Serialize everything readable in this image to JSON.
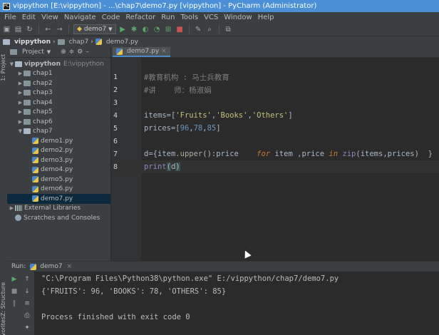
{
  "window": {
    "title": "vippython [E:\\vippython] - ...\\chap7\\demo7.py [vippython] - PyCharm (Administrator)"
  },
  "menu": [
    "File",
    "Edit",
    "View",
    "Navigate",
    "Code",
    "Refactor",
    "Run",
    "Tools",
    "VCS",
    "Window",
    "Help"
  ],
  "toolbar": {
    "run_config": "demo7"
  },
  "breadcrumb": [
    "vippython",
    "chap7",
    "demo7.py"
  ],
  "project_panel": {
    "title": "Project",
    "tool_window_label": "1: Project",
    "tree": [
      {
        "label": "vippython",
        "extra": "E:\\vippython",
        "type": "folder-open",
        "level": 0
      },
      {
        "label": "chap1",
        "type": "folder",
        "level": 1
      },
      {
        "label": "chap2",
        "type": "folder",
        "level": 1
      },
      {
        "label": "chap3",
        "type": "folder",
        "level": 1
      },
      {
        "label": "chap4",
        "type": "folder",
        "level": 1
      },
      {
        "label": "chap5",
        "type": "folder",
        "level": 1
      },
      {
        "label": "chap6",
        "type": "folder",
        "level": 1
      },
      {
        "label": "chap7",
        "type": "folder-open",
        "level": 1
      },
      {
        "label": "demo1.py",
        "type": "py",
        "level": 2
      },
      {
        "label": "demo2.py",
        "type": "py",
        "level": 2
      },
      {
        "label": "demo3.py",
        "type": "py",
        "level": 2
      },
      {
        "label": "demo4.py",
        "type": "py",
        "level": 2
      },
      {
        "label": "demo5.py",
        "type": "py",
        "level": 2
      },
      {
        "label": "demo6.py",
        "type": "py",
        "level": 2
      },
      {
        "label": "demo7.py",
        "type": "py",
        "level": 2,
        "selected": true
      },
      {
        "label": "External Libraries",
        "type": "lib",
        "level": 0
      },
      {
        "label": "Scratches and Consoles",
        "type": "scratch",
        "level": 0
      }
    ]
  },
  "editor": {
    "tab": "demo7.py",
    "lines": [
      {
        "n": "1",
        "text": "#教育机构 : 马士兵教育"
      },
      {
        "n": "2",
        "text": "#讲    师：杨淑娟"
      },
      {
        "n": "3",
        "text": ""
      },
      {
        "n": "4",
        "text": "items=['Fruits','Books','Others']"
      },
      {
        "n": "5",
        "text": "prices=[96,78,85]"
      },
      {
        "n": "6",
        "text": ""
      },
      {
        "n": "7",
        "text": "d={item.upper():price    for item ,price in zip(items,prices)  }"
      },
      {
        "n": "8",
        "text": "print(d)"
      }
    ]
  },
  "run_panel": {
    "label": "Run:",
    "tab": "demo7",
    "side_labels": [
      "Z: Structure",
      "Favorites"
    ],
    "output": [
      "\"C:\\Program Files\\Python38\\python.exe\" E:/vippython/chap7/demo7.py",
      "{'FRUITS': 96, 'BOOKS': 78, 'OTHERS': 85}",
      "",
      "Process finished with exit code 0"
    ]
  },
  "colors": {
    "accent": "#4b8fd6",
    "editor_bg": "#2b2b2b",
    "panel_bg": "#3c3f41",
    "selection": "#0d293e"
  }
}
